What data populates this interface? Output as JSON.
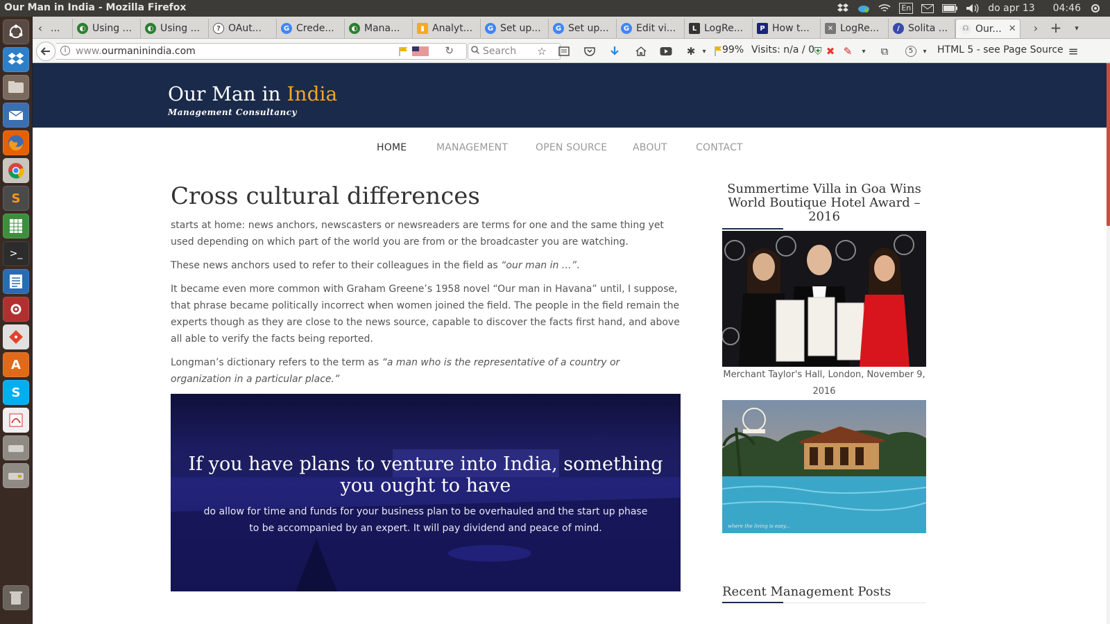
{
  "top_panel": {
    "window_title": "Our Man in India - Mozilla Firefox",
    "keyboard": "En",
    "date": "do apr 13",
    "time": "04:46"
  },
  "browser": {
    "tabs": [
      {
        "label": "...",
        "color": "#2e7d32"
      },
      {
        "label": "Using ...",
        "color": "#2e7d32"
      },
      {
        "label": "Using ...",
        "color": "#2e7d32"
      },
      {
        "label": "OAut...",
        "color": "#555555"
      },
      {
        "label": "Crede...",
        "color": "#4285f4"
      },
      {
        "label": "Mana...",
        "color": "#2e7d32"
      },
      {
        "label": "Analyt...",
        "color": "#f9a825"
      },
      {
        "label": "Set up...",
        "color": "#4285f4"
      },
      {
        "label": "Set up...",
        "color": "#4285f4"
      },
      {
        "label": "Edit vi...",
        "color": "#4285f4"
      },
      {
        "label": "LogRe...",
        "color": "#333333"
      },
      {
        "label": "How t...",
        "color": "#1a237e"
      },
      {
        "label": "LogRe...",
        "color": "#777777"
      },
      {
        "label": "Solita ...",
        "color": "#3949ab"
      },
      {
        "label": "Our...",
        "color": "#888888",
        "active": true
      }
    ],
    "url_prefix": "www.",
    "url_domain": "ourmaninindia.com",
    "search_placeholder": "Search",
    "zoom_indicator": "99%",
    "visits": "Visits: n/a / 0",
    "badge_count": "5",
    "html_note": "HTML 5 - see Page Source"
  },
  "site": {
    "title_main": "Our Man in ",
    "title_accent": "India",
    "tagline": "Management Consultancy",
    "nav": [
      "HOME",
      "MANAGEMENT",
      "OPEN SOURCE",
      "ABOUT",
      "CONTACT"
    ],
    "post": {
      "title": "Cross cultural differences",
      "p1": "starts at home: news anchors, newscasters or newsreaders are terms for one and the same thing yet used depending on which part of the world you are from or the broadcaster you are watching.",
      "p2_pre": "These news anchors used to refer to their colleagues in the field as ",
      "p2_em": "“our man in …”",
      "p2_post": ".",
      "p3": "It became even more common with Graham Greene’s 1958 novel “Our man in Havana” until, I suppose, that phrase became politically incorrect when women joined the field. The people in the field remain the experts though as they are close to the news source, capable to discover the facts first hand, and above all able to verify the facts being reported.",
      "p4_pre": "Longman’s dictionary refers to the term as ",
      "p4_em": "“a man who is the representative of a country or organization in a particular place.”",
      "hero_heading": "If you have plans to venture into India, something you ought to have",
      "hero_text": "do allow for time and funds for your business plan to be overhauled and the start up phase to be accompanied by an expert. It will pay dividend and peace of mind."
    },
    "sidebar": {
      "widget_title": "Summertime Villa in Goa Wins World Boutique Hotel Award – 2016",
      "caption": "Merchant Taylor's Hall, London, November 9, 2016",
      "recent_title": "Recent Management Posts"
    }
  },
  "colors": {
    "header_bg": "#1a2a4a",
    "accent": "#f5a623",
    "hero_bg": "#1a1a5e"
  }
}
